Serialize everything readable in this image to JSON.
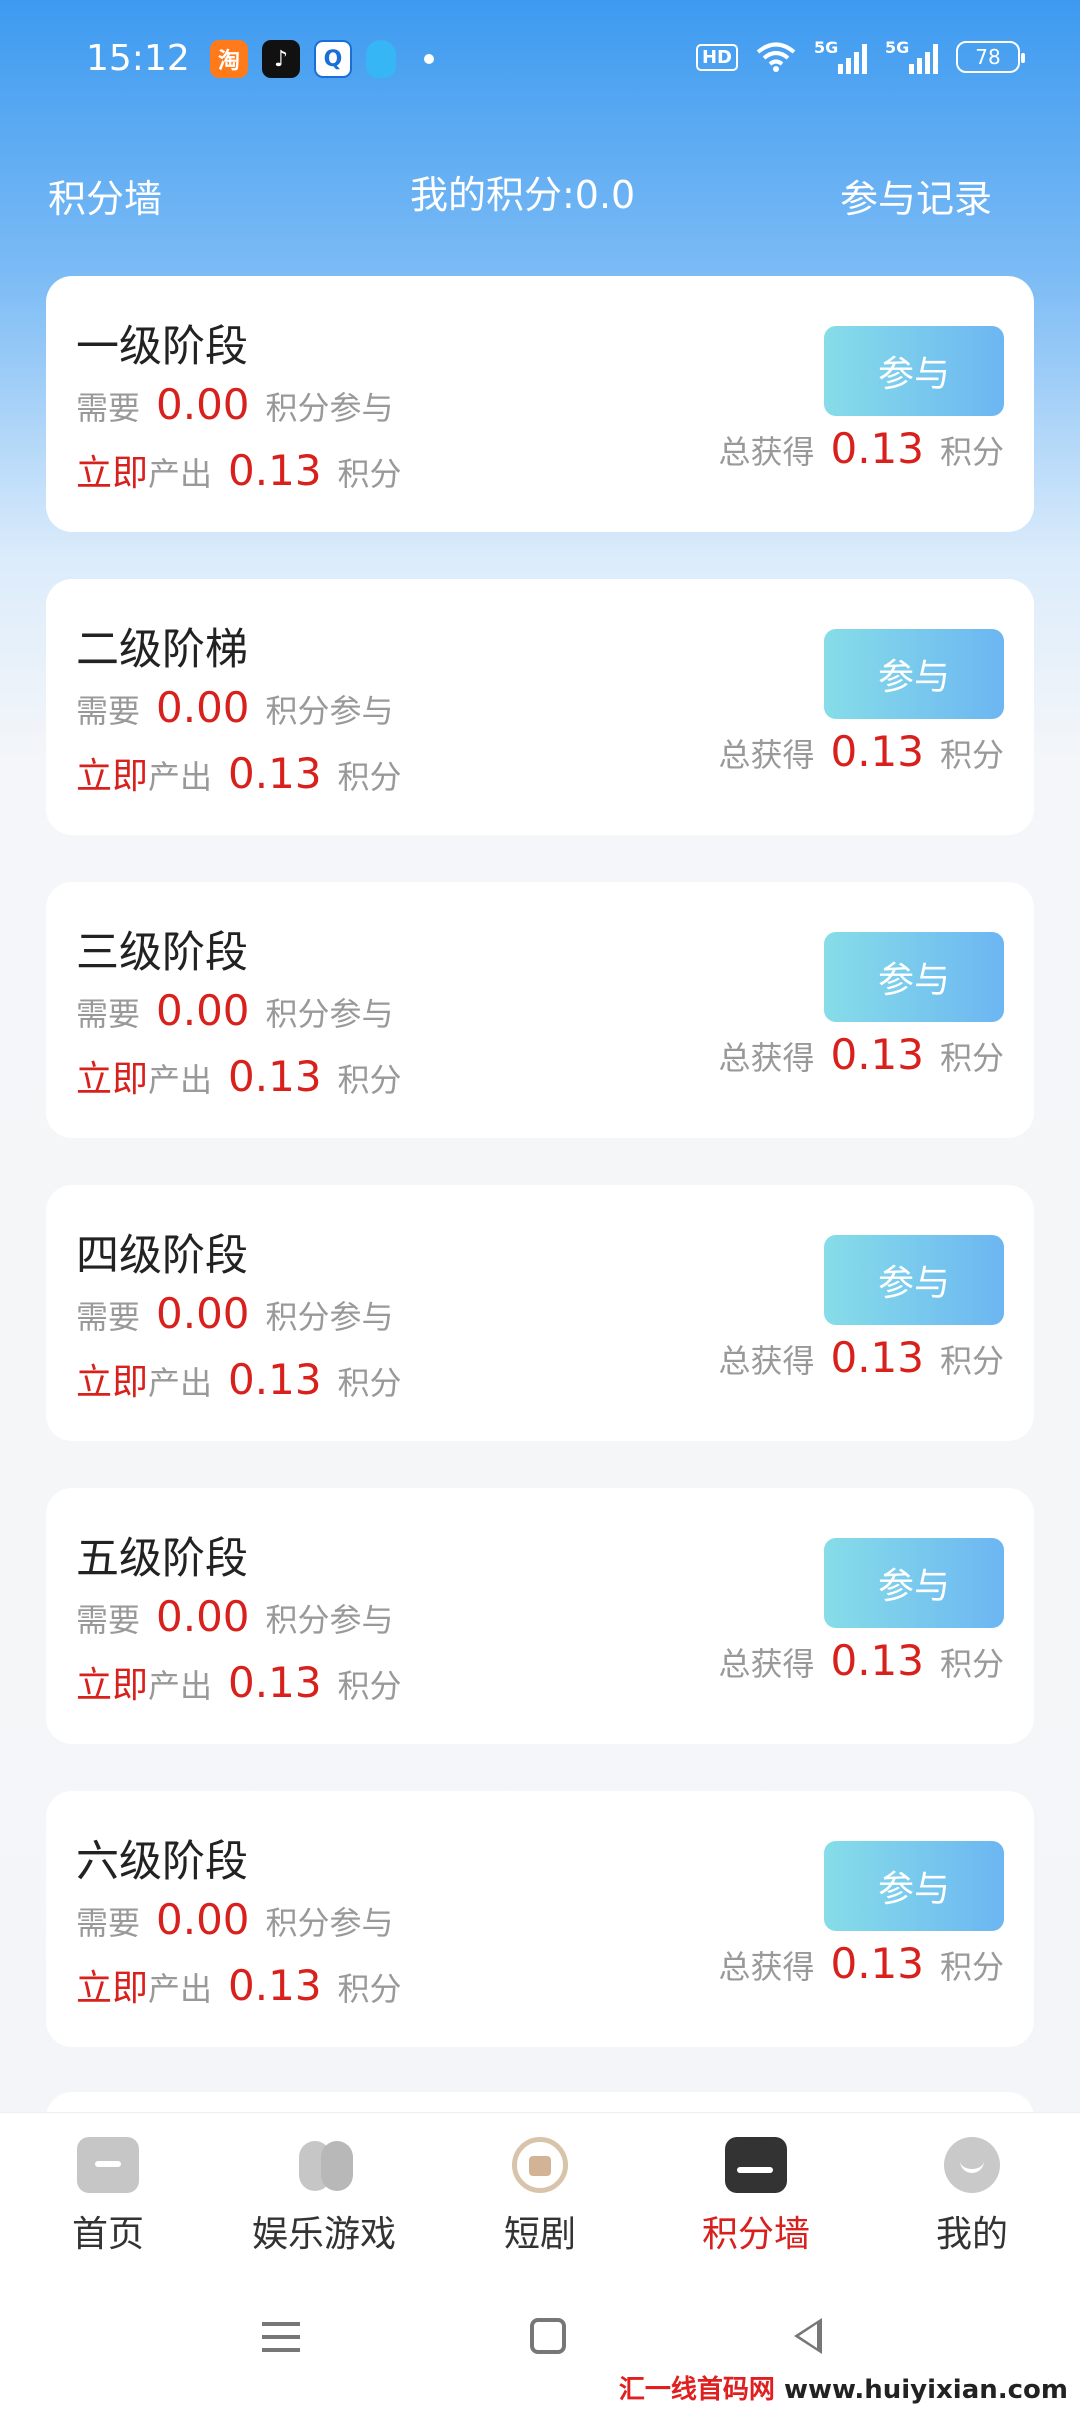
{
  "status_bar": {
    "time": "15:12",
    "app_icons": [
      "taobao-icon",
      "tiktok-icon",
      "q-app-icon",
      "qq-icon"
    ],
    "app_glyphs": {
      "taobao": "淘",
      "tiktok": "♪",
      "q": "Q"
    },
    "hd_label": "HD",
    "signal_1_label": "5G",
    "signal_2_label": "5G",
    "battery": "78"
  },
  "header": {
    "left": "积分墙",
    "points": "我的积分:0.0",
    "right": "参与记录"
  },
  "cards": [
    {
      "title": "一级阶段",
      "need_label": "需要",
      "need_value": "0.00",
      "need_suffix": "积分参与",
      "out_prefix": "立即",
      "out_label": "产出",
      "out_value": "0.13",
      "out_suffix": "积分",
      "button": "参与",
      "total_label": "总获得",
      "total_value": "0.13",
      "total_suffix": "积分"
    },
    {
      "title": "二级阶梯",
      "need_label": "需要",
      "need_value": "0.00",
      "need_suffix": "积分参与",
      "out_prefix": "立即",
      "out_label": "产出",
      "out_value": "0.13",
      "out_suffix": "积分",
      "button": "参与",
      "total_label": "总获得",
      "total_value": "0.13",
      "total_suffix": "积分"
    },
    {
      "title": "三级阶段",
      "need_label": "需要",
      "need_value": "0.00",
      "need_suffix": "积分参与",
      "out_prefix": "立即",
      "out_label": "产出",
      "out_value": "0.13",
      "out_suffix": "积分",
      "button": "参与",
      "total_label": "总获得",
      "total_value": "0.13",
      "total_suffix": "积分"
    },
    {
      "title": "四级阶段",
      "need_label": "需要",
      "need_value": "0.00",
      "need_suffix": "积分参与",
      "out_prefix": "立即",
      "out_label": "产出",
      "out_value": "0.13",
      "out_suffix": "积分",
      "button": "参与",
      "total_label": "总获得",
      "total_value": "0.13",
      "total_suffix": "积分"
    },
    {
      "title": "五级阶段",
      "need_label": "需要",
      "need_value": "0.00",
      "need_suffix": "积分参与",
      "out_prefix": "立即",
      "out_label": "产出",
      "out_value": "0.13",
      "out_suffix": "积分",
      "button": "参与",
      "total_label": "总获得",
      "total_value": "0.13",
      "total_suffix": "积分"
    },
    {
      "title": "六级阶段",
      "need_label": "需要",
      "need_value": "0.00",
      "need_suffix": "积分参与",
      "out_prefix": "立即",
      "out_label": "产出",
      "out_value": "0.13",
      "out_suffix": "积分",
      "button": "参与",
      "total_label": "总获得",
      "total_value": "0.13",
      "total_suffix": "积分"
    }
  ],
  "bottom_nav": [
    {
      "label": "首页",
      "icon": "home-icon",
      "active": false
    },
    {
      "label": "娱乐游戏",
      "icon": "games-icon",
      "active": false
    },
    {
      "label": "短剧",
      "icon": "short-drama-icon",
      "active": false
    },
    {
      "label": "积分墙",
      "icon": "points-wall-icon",
      "active": true
    },
    {
      "label": "我的",
      "icon": "profile-icon",
      "active": false
    }
  ],
  "watermark": {
    "part1": "汇一线首码网",
    "part2": "www.huiyixian.com"
  },
  "colors": {
    "accent_red": "#d8201c",
    "header_blue": "#3d9af0",
    "button_start": "#86dde8",
    "button_end": "#6cb6f2"
  }
}
